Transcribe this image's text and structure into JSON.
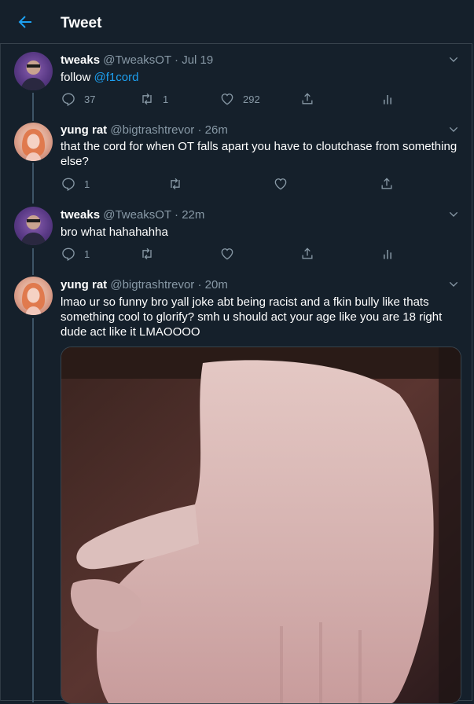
{
  "header": {
    "title": "Tweet",
    "back_icon": "arrow-left-icon"
  },
  "colors": {
    "background": "#15202b",
    "accent": "#1da1f2",
    "muted": "#8899a6",
    "divider": "#38444d"
  },
  "tweets": [
    {
      "name": "tweaks",
      "handle": "@TweaksOT",
      "dot": "·",
      "time": "Jul 19",
      "text_prefix": "follow ",
      "text_link": "@f1cord",
      "text": "",
      "replies": "37",
      "retweets": "1",
      "likes": "292"
    },
    {
      "name": "yung rat",
      "handle": "@bigtrashtrevor",
      "dot": "·",
      "time": "26m",
      "text_line1": "that the cord for when OT falls apart you have to cloutchase from something",
      "text_line2": "else?",
      "replies": "1",
      "retweets": "",
      "likes": ""
    },
    {
      "name": "tweaks",
      "handle": "@TweaksOT",
      "dot": "·",
      "time": "22m",
      "text": "bro what hahahahha",
      "replies": "1",
      "retweets": "",
      "likes": ""
    },
    {
      "name": "yung rat",
      "handle": "@bigtrashtrevor",
      "dot": "·",
      "time": "20m",
      "text_line1": "lmao ur so funny bro yall joke abt being racist and a fkin bully like thats",
      "text_line2": "something cool to glorify? smh u should act your age like you are 18 right",
      "text_line3": "dude act like it LMAOOOO"
    }
  ]
}
